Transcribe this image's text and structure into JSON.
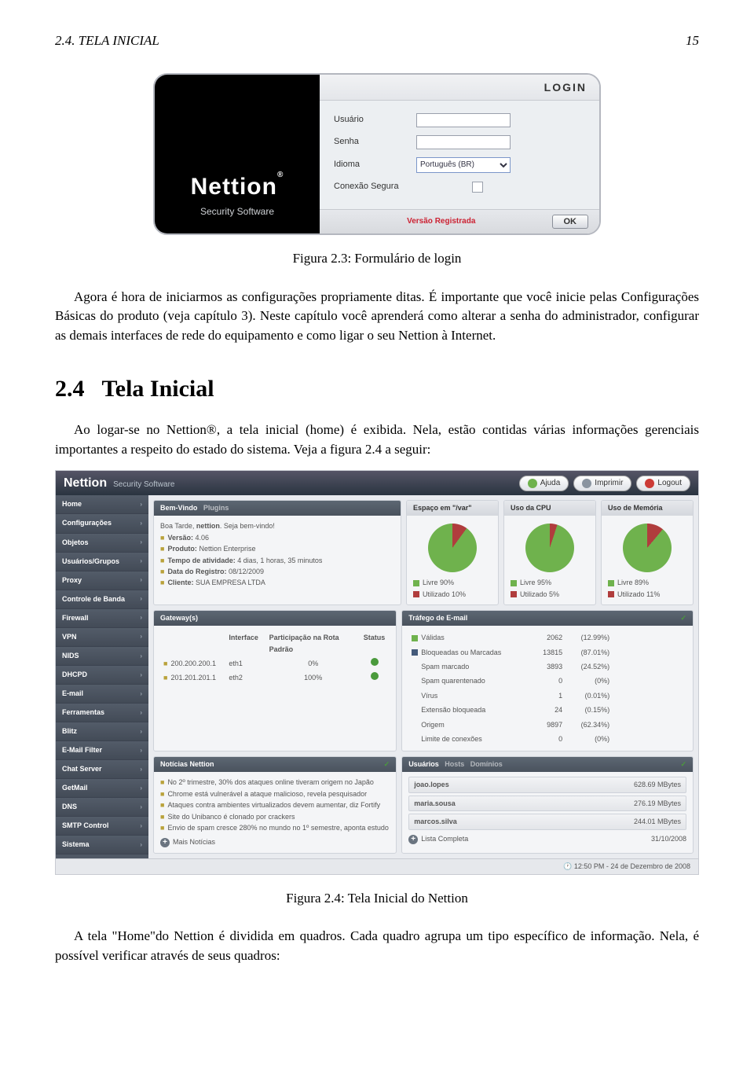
{
  "header": {
    "section_ref": "2.4. TELA INICIAL",
    "page_num": "15"
  },
  "fig23_caption": "Figura 2.3: Formulário de login",
  "para1": "Agora é hora de iniciarmos as configurações propriamente ditas. É importante que você inicie pelas Configurações Básicas do produto (veja capítulo 3). Neste capítulo você aprenderá como alterar a senha do administrador, configurar as demais interfaces de rede do equipamento e como ligar o seu Nettion à Internet.",
  "section24": {
    "num": "2.4",
    "title": "Tela Inicial"
  },
  "para2": "Ao logar-se no Nettion®, a tela inicial (home) é exibida. Nela, estão contidas várias informações gerenciais importantes a respeito do estado do sistema. Veja a figura 2.4 a seguir:",
  "fig24_caption": "Figura 2.4: Tela Inicial do Nettion",
  "para3": "A tela \"Home\"do Nettion é dividida em quadros. Cada quadro agrupa um tipo específico de informação. Nela, é possível verificar através de seus quadros:",
  "login": {
    "brand": "Nettion",
    "brand_sub": "Security Software",
    "title": "LOGIN",
    "user_label": "Usuário",
    "pass_label": "Senha",
    "lang_label": "Idioma",
    "lang_value": "Português (BR)",
    "secure_label": "Conexão Segura",
    "version_text": "Versão Registrada",
    "ok": "OK"
  },
  "dash": {
    "brand": "Nettion",
    "brand_sub": "Security Software",
    "btn_help": "Ajuda",
    "btn_print": "Imprimir",
    "btn_logout": "Logout",
    "sidebar": [
      "Home",
      "Configurações",
      "Objetos",
      "Usuários/Grupos",
      "Proxy",
      "Controle de Banda",
      "Firewall",
      "VPN",
      "NIDS",
      "DHCPD",
      "E-mail",
      "Ferramentas",
      "Blitz",
      "E-Mail Filter",
      "Chat Server",
      "GetMail",
      "DNS",
      "SMTP Control",
      "Sistema"
    ],
    "welcome": {
      "tab1": "Bem-Vindo",
      "tab2": "Plugins",
      "greeting_pre": "Boa Tarde, ",
      "greeting_user": "nettion",
      "greeting_post": ". Seja bem-vindo!",
      "lines": [
        {
          "l": "Versão:",
          "v": "4.06"
        },
        {
          "l": "Produto:",
          "v": "Nettion Enterprise"
        },
        {
          "l": "Tempo de atividade:",
          "v": "4 dias, 1 horas, 35 minutos"
        },
        {
          "l": "Data do Registro:",
          "v": "08/12/2009"
        },
        {
          "l": "Cliente:",
          "v": "SUA EMPRESA LTDA"
        }
      ]
    },
    "gauges": [
      {
        "title": "Espaço em \"/var\"",
        "free": "Livre 90%",
        "used": "Utilizado 10%",
        "deg": 36
      },
      {
        "title": "Uso da CPU",
        "free": "Livre 95%",
        "used": "Utilizado 5%",
        "deg": 18
      },
      {
        "title": "Uso de Memória",
        "free": "Livre 89%",
        "used": "Utilizado 11%",
        "deg": 40
      }
    ],
    "gateways": {
      "title": "Gateway(s)",
      "cols": [
        "Interface",
        "Participação na Rota Padrão",
        "Status"
      ],
      "rows": [
        {
          "ip": "200.200.200.1",
          "if": "eth1",
          "p": "0%",
          "s": "green"
        },
        {
          "ip": "201.201.201.1",
          "if": "eth2",
          "p": "100%",
          "s": "green"
        }
      ]
    },
    "email": {
      "title": "Tráfego de E-mail",
      "rows": [
        {
          "k": "Válidas",
          "c": "2062",
          "p": "(12.99%)",
          "sq": "#6fb24d"
        },
        {
          "k": "Bloqueadas ou Marcadas",
          "c": "13815",
          "p": "(87.01%)",
          "sq": "#445a7a"
        },
        {
          "k": "Spam marcado",
          "c": "3893",
          "p": "(24.52%)"
        },
        {
          "k": "Spam quarentenado",
          "c": "0",
          "p": "(0%)"
        },
        {
          "k": "Vírus",
          "c": "1",
          "p": "(0.01%)"
        },
        {
          "k": "Extensão bloqueada",
          "c": "24",
          "p": "(0.15%)"
        },
        {
          "k": "Origem",
          "c": "9897",
          "p": "(62.34%)"
        },
        {
          "k": "Limite de conexões",
          "c": "0",
          "p": "(0%)"
        }
      ]
    },
    "news": {
      "title": "Notícias Nettion",
      "items": [
        "No 2º trimestre, 30% dos ataques online tiveram origem no Japão",
        "Chrome está vulnerável a ataque malicioso, revela pesquisador",
        "Ataques contra ambientes virtualizados devem aumentar, diz Fortify",
        "Site do Unibanco é clonado por crackers",
        "Envio de spam cresce 280% no mundo no 1º semestre, aponta estudo"
      ],
      "more": "Mais Notícias"
    },
    "users": {
      "tabs": [
        "Usuários",
        "Hosts",
        "Domínios"
      ],
      "rows": [
        {
          "u": "joao.lopes",
          "b": "628.69 MBytes"
        },
        {
          "u": "maria.sousa",
          "b": "276.19 MBytes"
        },
        {
          "u": "marcos.silva",
          "b": "244.01 MBytes"
        }
      ],
      "list_all": "Lista Completa",
      "date": "31/10/2008"
    },
    "status": "12:50 PM - 24 de Dezembro de 2008"
  }
}
